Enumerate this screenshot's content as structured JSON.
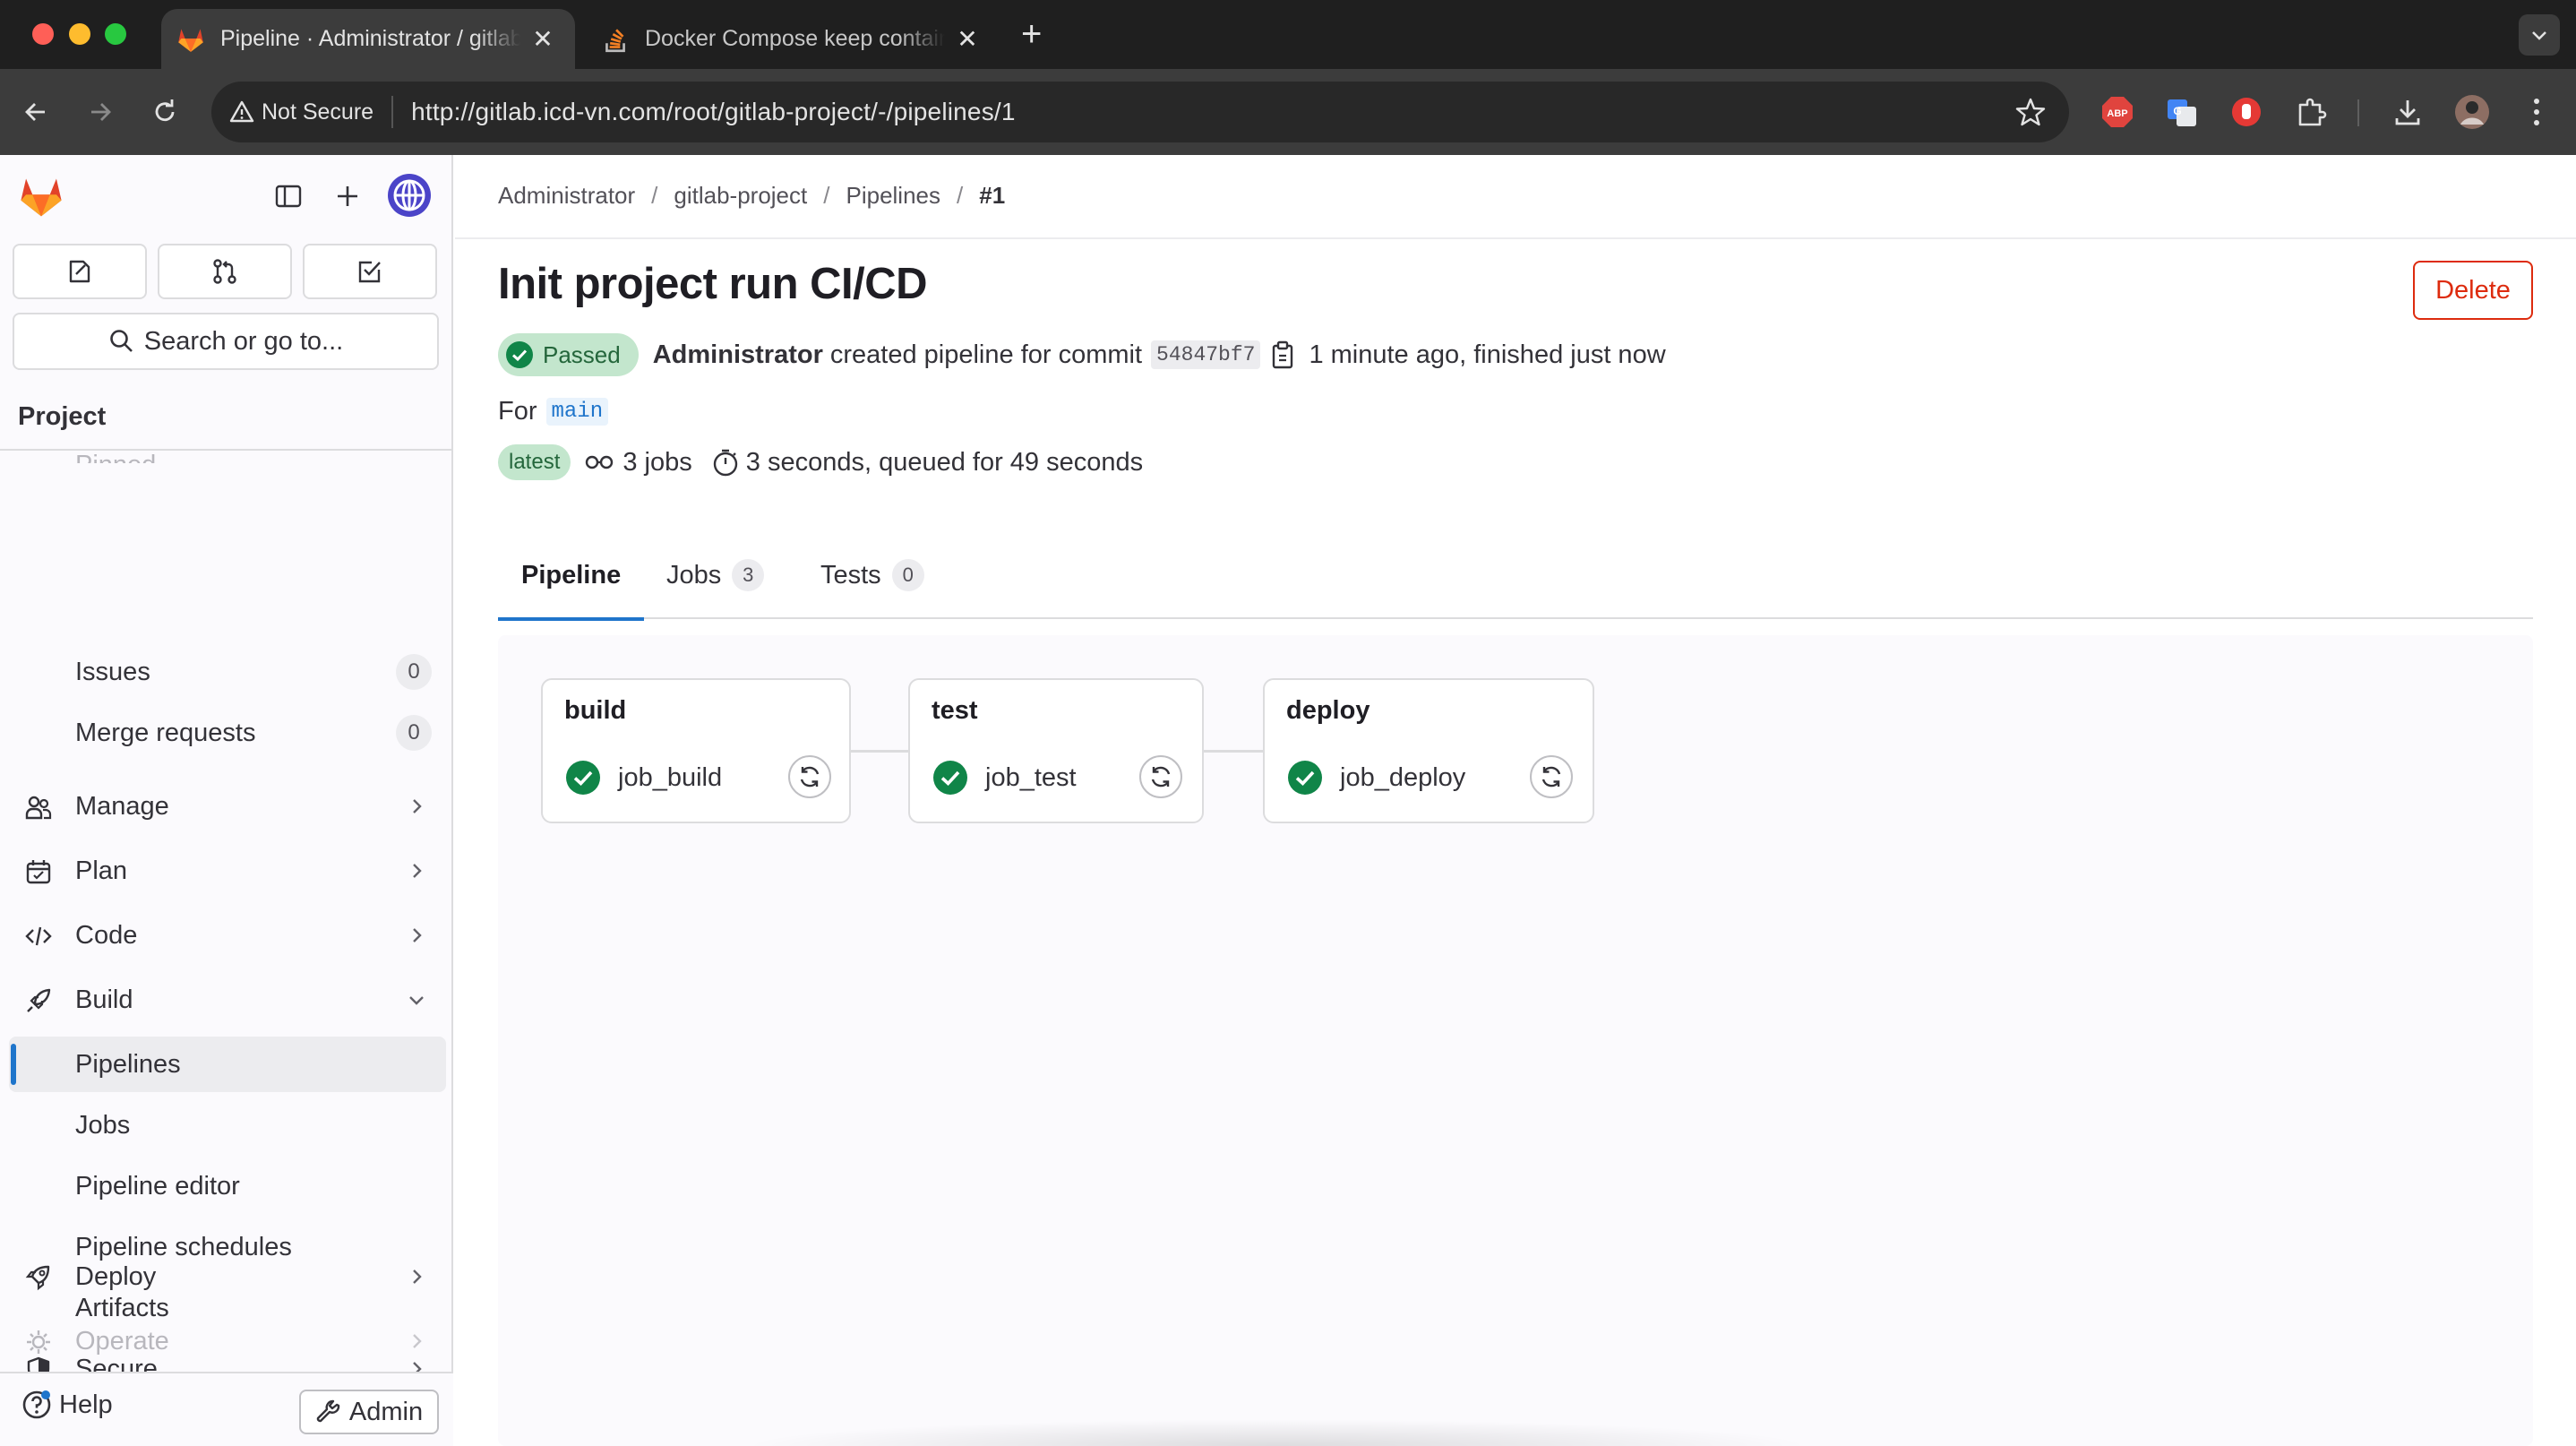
{
  "browser": {
    "tabs": [
      {
        "title": "Pipeline · Administrator / gitlab-project",
        "icon": "gitlab-tanuki-icon",
        "active": true,
        "close": "✕"
      },
      {
        "title": "Docker Compose keep container running",
        "icon": "stackoverflow-icon",
        "active": false,
        "close": "✕"
      }
    ],
    "new_tab": "+",
    "security_label": "Not Secure",
    "url": "http://gitlab.icd-vn.com/root/gitlab-project/-/pipelines/1"
  },
  "sidebar": {
    "search_label": "Search or go to...",
    "section_title": "Project",
    "faded_top": "Pinned",
    "items": [
      {
        "label": "Issues",
        "count": "0"
      },
      {
        "label": "Merge requests",
        "count": "0"
      },
      {
        "label": "Manage"
      },
      {
        "label": "Plan"
      },
      {
        "label": "Code"
      },
      {
        "label": "Build"
      },
      {
        "label": "Pipelines"
      },
      {
        "label": "Jobs"
      },
      {
        "label": "Pipeline editor"
      },
      {
        "label": "Pipeline schedules"
      },
      {
        "label": "Artifacts"
      },
      {
        "label": "Secure"
      },
      {
        "label": "Deploy"
      },
      {
        "label": "Operate"
      }
    ],
    "help_label": "Help",
    "admin_label": "Admin"
  },
  "breadcrumb": {
    "items": [
      "Administrator",
      "gitlab-project",
      "Pipelines",
      "#1"
    ],
    "separator": "/"
  },
  "pipeline": {
    "title": "Init project run CI/CD",
    "delete_label": "Delete",
    "status": "Passed",
    "author": "Administrator",
    "created_text": "created pipeline for commit",
    "commit_sha": "54847bf7",
    "time_text": "1 minute ago, finished just now",
    "for_label": "For",
    "ref": "main",
    "latest_badge": "latest",
    "jobs_count": "3 jobs",
    "duration_text": "3 seconds, queued for 49 seconds"
  },
  "tabs": [
    {
      "label": "Pipeline"
    },
    {
      "label": "Jobs",
      "count": "3"
    },
    {
      "label": "Tests",
      "count": "0"
    }
  ],
  "stages": [
    {
      "name": "build",
      "job": "job_build",
      "status": "success"
    },
    {
      "name": "test",
      "job": "job_test",
      "status": "success"
    },
    {
      "name": "deploy",
      "job": "job_deploy",
      "status": "success"
    }
  ],
  "colors": {
    "success": "#108548",
    "link": "#1f75cb",
    "danger": "#dd2b0e",
    "brand": "#fc6d26"
  }
}
